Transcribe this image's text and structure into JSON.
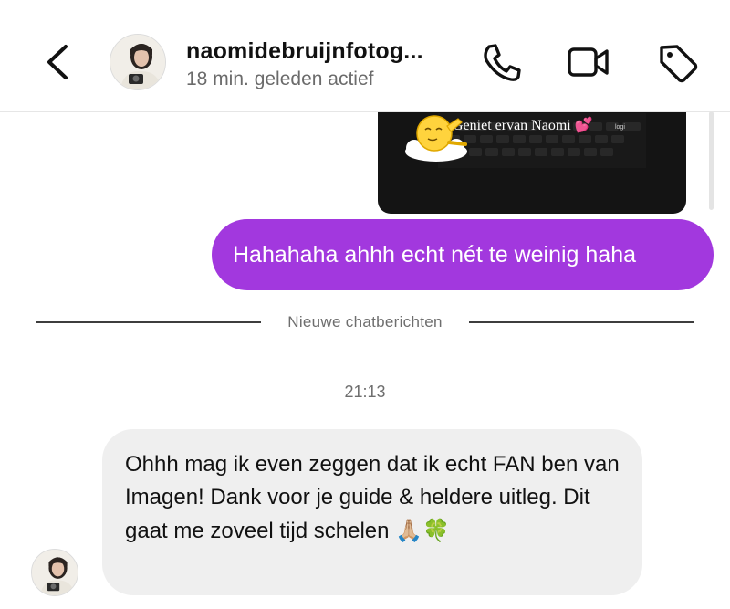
{
  "header": {
    "contact_name": "naomidebruijnfotog...",
    "status": "18 min. geleden actief",
    "icons": [
      "back-arrow-icon",
      "profile-avatar",
      "phone-icon",
      "video-camera-icon",
      "tag-icon"
    ]
  },
  "shared_media": {
    "caption": "Geniet ervan Naomi 💕",
    "tiny_text": "logi",
    "sticker": "sunbathing-sun-sticker"
  },
  "messages": {
    "outgoing_1": "Hahahaha ahhh echt nét te weinig haha",
    "divider_label": "Nieuwe chatberichten",
    "timestamp": "21:13",
    "incoming_1": "Ohhh mag ik even zeggen dat ik echt FAN ben van Imagen! Dank voor je guide & heldere uitleg. Dit gaat me zoveel tijd schelen",
    "incoming_1_emojis": "🙏🏼🍀"
  },
  "colors": {
    "outgoing_bubble": "#a238de",
    "incoming_bubble": "#efefef",
    "divider": "#3d3d3d",
    "muted_text": "#6e6e6e"
  }
}
